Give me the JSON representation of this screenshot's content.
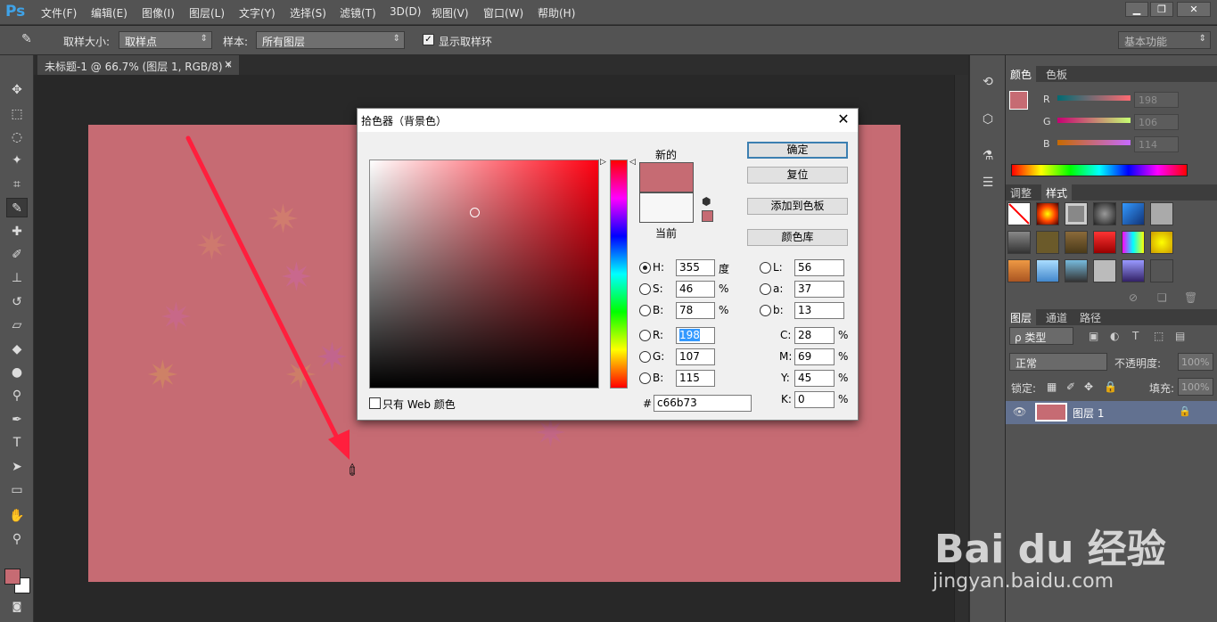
{
  "app": {
    "logo": "Ps"
  },
  "menu": [
    "文件(F)",
    "编辑(E)",
    "图像(I)",
    "图层(L)",
    "文字(Y)",
    "选择(S)",
    "滤镜(T)",
    "3D(D)",
    "视图(V)",
    "窗口(W)",
    "帮助(H)"
  ],
  "window_controls": {
    "minimize": "▁",
    "restore": "❐",
    "close": "✕"
  },
  "options": {
    "sample_size_label": "取样大小:",
    "sample_size_value": "取样点",
    "sample_label": "样本:",
    "sample_value": "所有图层",
    "show_ring_label": "显示取样环",
    "workspace": "基本功能"
  },
  "document_tab": {
    "title": "未标题-1 @ 66.7% (图层 1, RGB/8) *",
    "close": "×"
  },
  "panels": {
    "color_tabs": [
      "颜色",
      "色板"
    ],
    "sliders": [
      {
        "label": "R",
        "value": "198"
      },
      {
        "label": "G",
        "value": "106"
      },
      {
        "label": "B",
        "value": "114"
      }
    ],
    "adjust_tabs": [
      "调整",
      "样式"
    ],
    "layers_tabs": [
      "图层",
      "通道",
      "路径"
    ],
    "filter_kind": "ρ 类型",
    "blend_mode": "正常",
    "opacity_label": "不透明度:",
    "opacity_value": "100%",
    "lock_label": "锁定:",
    "fill_label": "填充:",
    "fill_value": "100%",
    "layer_name": "图层 1"
  },
  "dialog": {
    "title": "拾色器（背景色）",
    "new_label": "新的",
    "current_label": "当前",
    "buttons": {
      "ok": "确定",
      "reset": "复位",
      "add_swatch": "添加到色板",
      "library": "颜色库"
    },
    "hsb": [
      {
        "label": "H:",
        "value": "355",
        "unit": "度"
      },
      {
        "label": "S:",
        "value": "46",
        "unit": "%"
      },
      {
        "label": "B:",
        "value": "78",
        "unit": "%"
      }
    ],
    "rgb": [
      {
        "label": "R:",
        "value": "198"
      },
      {
        "label": "G:",
        "value": "107"
      },
      {
        "label": "B:",
        "value": "115"
      }
    ],
    "lab": [
      {
        "label": "L:",
        "value": "56"
      },
      {
        "label": "a:",
        "value": "37"
      },
      {
        "label": "b:",
        "value": "13"
      }
    ],
    "cmyk": [
      {
        "label": "C:",
        "value": "28",
        "unit": "%"
      },
      {
        "label": "M:",
        "value": "69",
        "unit": "%"
      },
      {
        "label": "Y:",
        "value": "45",
        "unit": "%"
      },
      {
        "label": "K:",
        "value": "0",
        "unit": "%"
      }
    ],
    "hex_label": "#",
    "hex_value": "c66b73",
    "web_only_label": "只有 Web 颜色"
  },
  "colors": {
    "new_color": "#c66b73",
    "current_color": "#f7f7f7",
    "hue_red": "#ff0000",
    "arrow": "#ff1f3d"
  },
  "watermark": {
    "brand": "Bai du 经验",
    "url": "jingyan.baidu.com"
  }
}
